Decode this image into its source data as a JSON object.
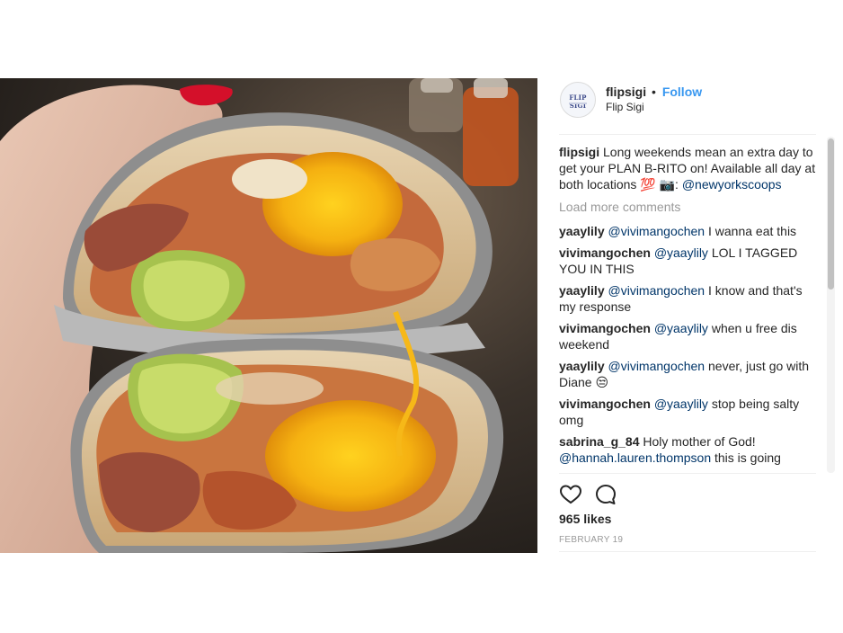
{
  "post": {
    "username": "flipsigi",
    "separator": "•",
    "follow_label": "Follow",
    "location": "Flip Sigi",
    "avatar_logo": "FLIP SIGI",
    "photo_icon": "burrito-photo"
  },
  "caption": {
    "username": "flipsigi",
    "text": "Long weekends mean an extra day to get your PLAN B-RITO on! Available all day at both locations 💯 📷: ",
    "mention": "@newyorkscoops"
  },
  "load_more_label": "Load more comments",
  "comments": [
    {
      "username": "yaaylily",
      "mention": "@vivimangochen",
      "text": " I wanna eat this"
    },
    {
      "username": "vivimangochen",
      "mention": "@yaaylily",
      "text": " LOL I TAGGED YOU IN THIS"
    },
    {
      "username": "yaaylily",
      "mention": "@vivimangochen",
      "text": " I know and that's my response"
    },
    {
      "username": "vivimangochen",
      "mention": "@yaaylily",
      "text": " when u free dis weekend"
    },
    {
      "username": "yaaylily",
      "mention": "@vivimangochen",
      "text": " never, just go with Diane 😒"
    },
    {
      "username": "vivimangochen",
      "mention": "@yaaylily",
      "text": " stop being salty omg"
    },
    {
      "username": "sabrina_g_84",
      "mention": "",
      "text": "Holy mother of God! "
    },
    {
      "username": "",
      "mention": "@hannah.lauren.thompson",
      "text": " this is going"
    }
  ],
  "actions": {
    "like_icon": "heart-icon",
    "comment_icon": "comment-icon",
    "likes_text": "965 likes",
    "date_text": "FEBRUARY 19"
  },
  "colors": {
    "link": "#3897f0",
    "mention": "#003569",
    "muted": "#999999",
    "text": "#262626"
  }
}
